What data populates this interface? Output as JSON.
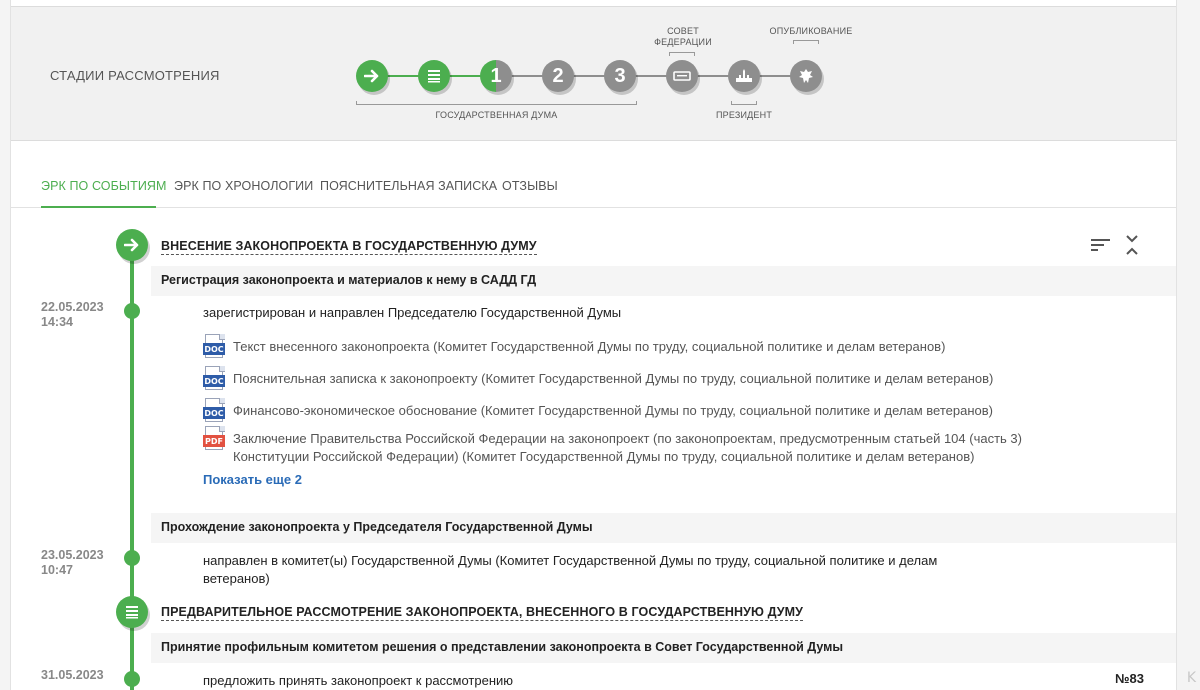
{
  "stages": {
    "title": "СТАДИИ РАССМОТРЕНИЯ",
    "steps": [
      {
        "kind": "arrow",
        "state": "green"
      },
      {
        "kind": "list",
        "state": "green"
      },
      {
        "kind": "num",
        "label": "1",
        "state": "half"
      },
      {
        "kind": "num",
        "label": "2",
        "state": "gray"
      },
      {
        "kind": "num",
        "label": "3",
        "state": "gray"
      },
      {
        "kind": "council",
        "state": "gray"
      },
      {
        "kind": "president",
        "state": "gray"
      },
      {
        "kind": "emblem",
        "state": "gray"
      }
    ],
    "label_duma": "ГОСУДАРСТВЕННАЯ ДУМА",
    "label_council": "СОВЕТ ФЕДЕРАЦИИ",
    "label_president": "ПРЕЗИДЕНТ",
    "label_publish": "ОПУБЛИКОВАНИЕ",
    "accent": "#4cae4f",
    "inactive": "#8e8e8e"
  },
  "tabs": [
    {
      "label": "ЭРК ПО СОБЫТИЯМ",
      "active": true
    },
    {
      "label": "ЭРК ПО ХРОНОЛОГИИ",
      "active": false
    },
    {
      "label": "ПОЯСНИТЕЛЬНАЯ ЗАПИСКА",
      "active": false
    },
    {
      "label": "ОТЗЫВЫ",
      "active": false
    }
  ],
  "timeline": {
    "stage1": {
      "title": "ВНЕСЕНИЕ ЗАКОНОПРОЕКТА В ГОСУДАРСТВЕННУЮ ДУМУ",
      "icon": "arrow-right-icon"
    },
    "sub1": "Регистрация законопроекта и материалов к нему в САДД ГД",
    "event1": {
      "date": "22.05.2023",
      "time": "14:34",
      "text": "зарегистрирован и направлен Председателю Государственной Думы",
      "docs": [
        {
          "type": "DOC",
          "text": "Текст внесенного законопроекта (Комитет Государственной Думы по труду, социальной политике и делам ветеранов)"
        },
        {
          "type": "DOC",
          "text": "Пояснительная записка к законопроекту (Комитет Государственной Думы по труду, социальной политике и делам ветеранов)"
        },
        {
          "type": "DOC",
          "text": "Финансово-экономическое обоснование (Комитет Государственной Думы по труду, социальной политике и делам ветеранов)"
        },
        {
          "type": "PDF",
          "text_line1": "Заключение Правительства Российской Федерации на законопроект (по законопроектам, предусмотренным статьей 104 (часть 3)",
          "text_line2": "Конституции Российской Федерации) (Комитет Государственной Думы по труду, социальной политике и делам ветеранов)"
        }
      ],
      "show_more": "Показать еще 2"
    },
    "sub2": "Прохождение законопроекта у Председателя Государственной Думы",
    "event2": {
      "date": "23.05.2023",
      "time": "10:47",
      "text_line1": "направлен в комитет(ы) Государственной Думы (Комитет Государственной Думы по труду, социальной политике и делам",
      "text_line2": "ветеранов)"
    },
    "stage2": {
      "title": "ПРЕДВАРИТЕЛЬНОЕ РАССМОТРЕНИЕ ЗАКОНОПРОЕКТА, ВНЕСЕННОГО В ГОСУДАРСТВЕННУЮ ДУМУ",
      "icon": "list-icon"
    },
    "sub3": "Принятие профильным комитетом решения о представлении законопроекта в Совет Государственной Думы",
    "event3": {
      "date": "31.05.2023",
      "text": "предложить принять законопроект к рассмотрению",
      "number": "№83"
    }
  }
}
